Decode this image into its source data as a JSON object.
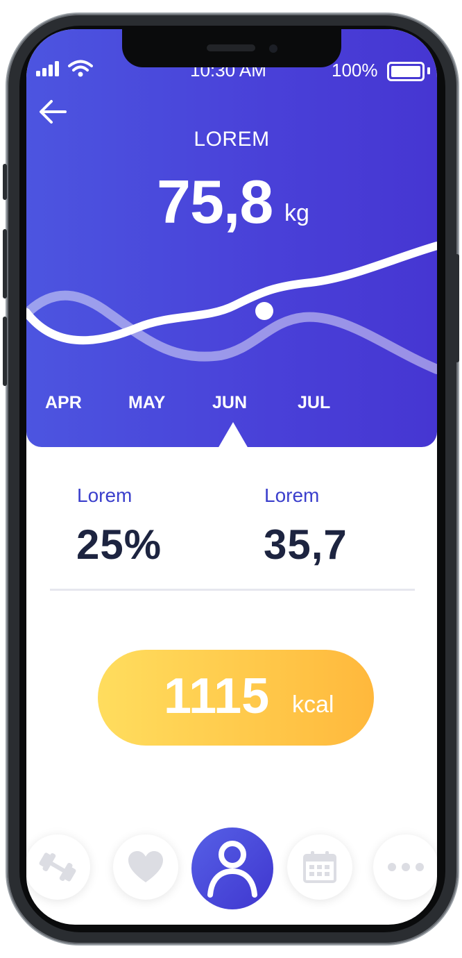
{
  "status_bar": {
    "time": "10:30 AM",
    "battery_percent": "100%"
  },
  "header": {
    "label": "LOREM",
    "value": "75,8",
    "unit": "kg"
  },
  "months": [
    {
      "label": "APR"
    },
    {
      "label": "MAY"
    },
    {
      "label": "JUN"
    },
    {
      "label": "JUL"
    }
  ],
  "stats": [
    {
      "label": "Lorem",
      "value": "25%"
    },
    {
      "label": "Lorem",
      "value": "35,7"
    }
  ],
  "calories": {
    "value": "1115",
    "unit": "kcal"
  },
  "nav": [
    {
      "icon": "dumbbell-icon"
    },
    {
      "icon": "heart-icon"
    },
    {
      "icon": "user-icon"
    },
    {
      "icon": "calendar-icon"
    },
    {
      "icon": "more-icon"
    }
  ],
  "colors": {
    "primary": "#4a46d8",
    "accent_gradient_start": "#ffdd5e",
    "accent_gradient_end": "#ffb83c",
    "text_dark": "#1d2440",
    "nav_icon": "#dcdde3"
  }
}
